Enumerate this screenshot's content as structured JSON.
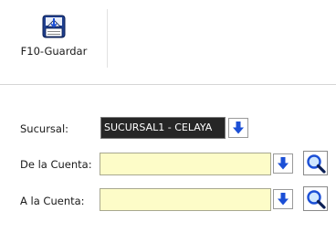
{
  "toolbar": {
    "save_label": "F10-Guardar",
    "save_icon": "save-to-disk-icon"
  },
  "form": {
    "branch": {
      "label": "Sucursal:",
      "value": "SUCURSAL1 - CELAYA"
    },
    "from_account": {
      "label": "De la Cuenta:",
      "value": ""
    },
    "to_account": {
      "label": "A la Cuenta:",
      "value": ""
    }
  },
  "colors": {
    "field_background": "#fdfcc8",
    "branch_background": "#262626",
    "arrow_blue": "#1b4fd6"
  }
}
